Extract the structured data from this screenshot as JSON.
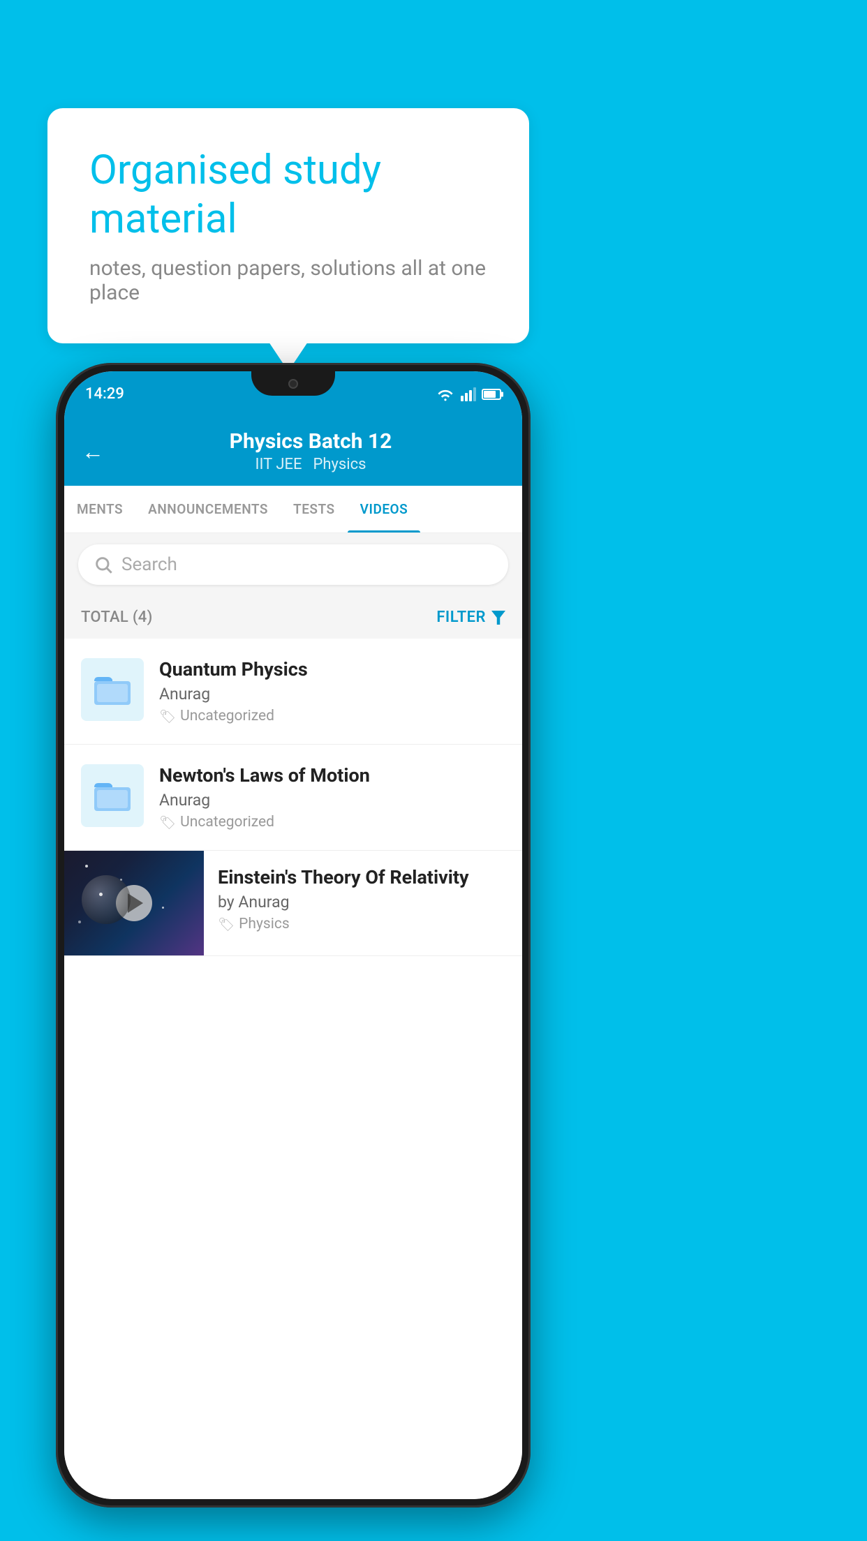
{
  "page": {
    "bg_color": "#00BFEA"
  },
  "bubble": {
    "title": "Organised study material",
    "subtitle": "notes, question papers, solutions all at one place"
  },
  "status_bar": {
    "time": "14:29"
  },
  "app_header": {
    "title": "Physics Batch 12",
    "subtitle_left": "IIT JEE",
    "subtitle_right": "Physics",
    "back_label": "←"
  },
  "tabs": [
    {
      "label": "MENTS",
      "active": false
    },
    {
      "label": "ANNOUNCEMENTS",
      "active": false
    },
    {
      "label": "TESTS",
      "active": false
    },
    {
      "label": "VIDEOS",
      "active": true
    }
  ],
  "search": {
    "placeholder": "Search"
  },
  "filter_bar": {
    "total_label": "TOTAL (4)",
    "filter_label": "FILTER"
  },
  "videos": [
    {
      "title": "Quantum Physics",
      "author": "Anurag",
      "tag": "Uncategorized",
      "has_thumb": false
    },
    {
      "title": "Newton's Laws of Motion",
      "author": "Anurag",
      "tag": "Uncategorized",
      "has_thumb": false
    },
    {
      "title": "Einstein's Theory Of Relativity",
      "author": "by Anurag",
      "tag": "Physics",
      "has_thumb": true
    }
  ]
}
